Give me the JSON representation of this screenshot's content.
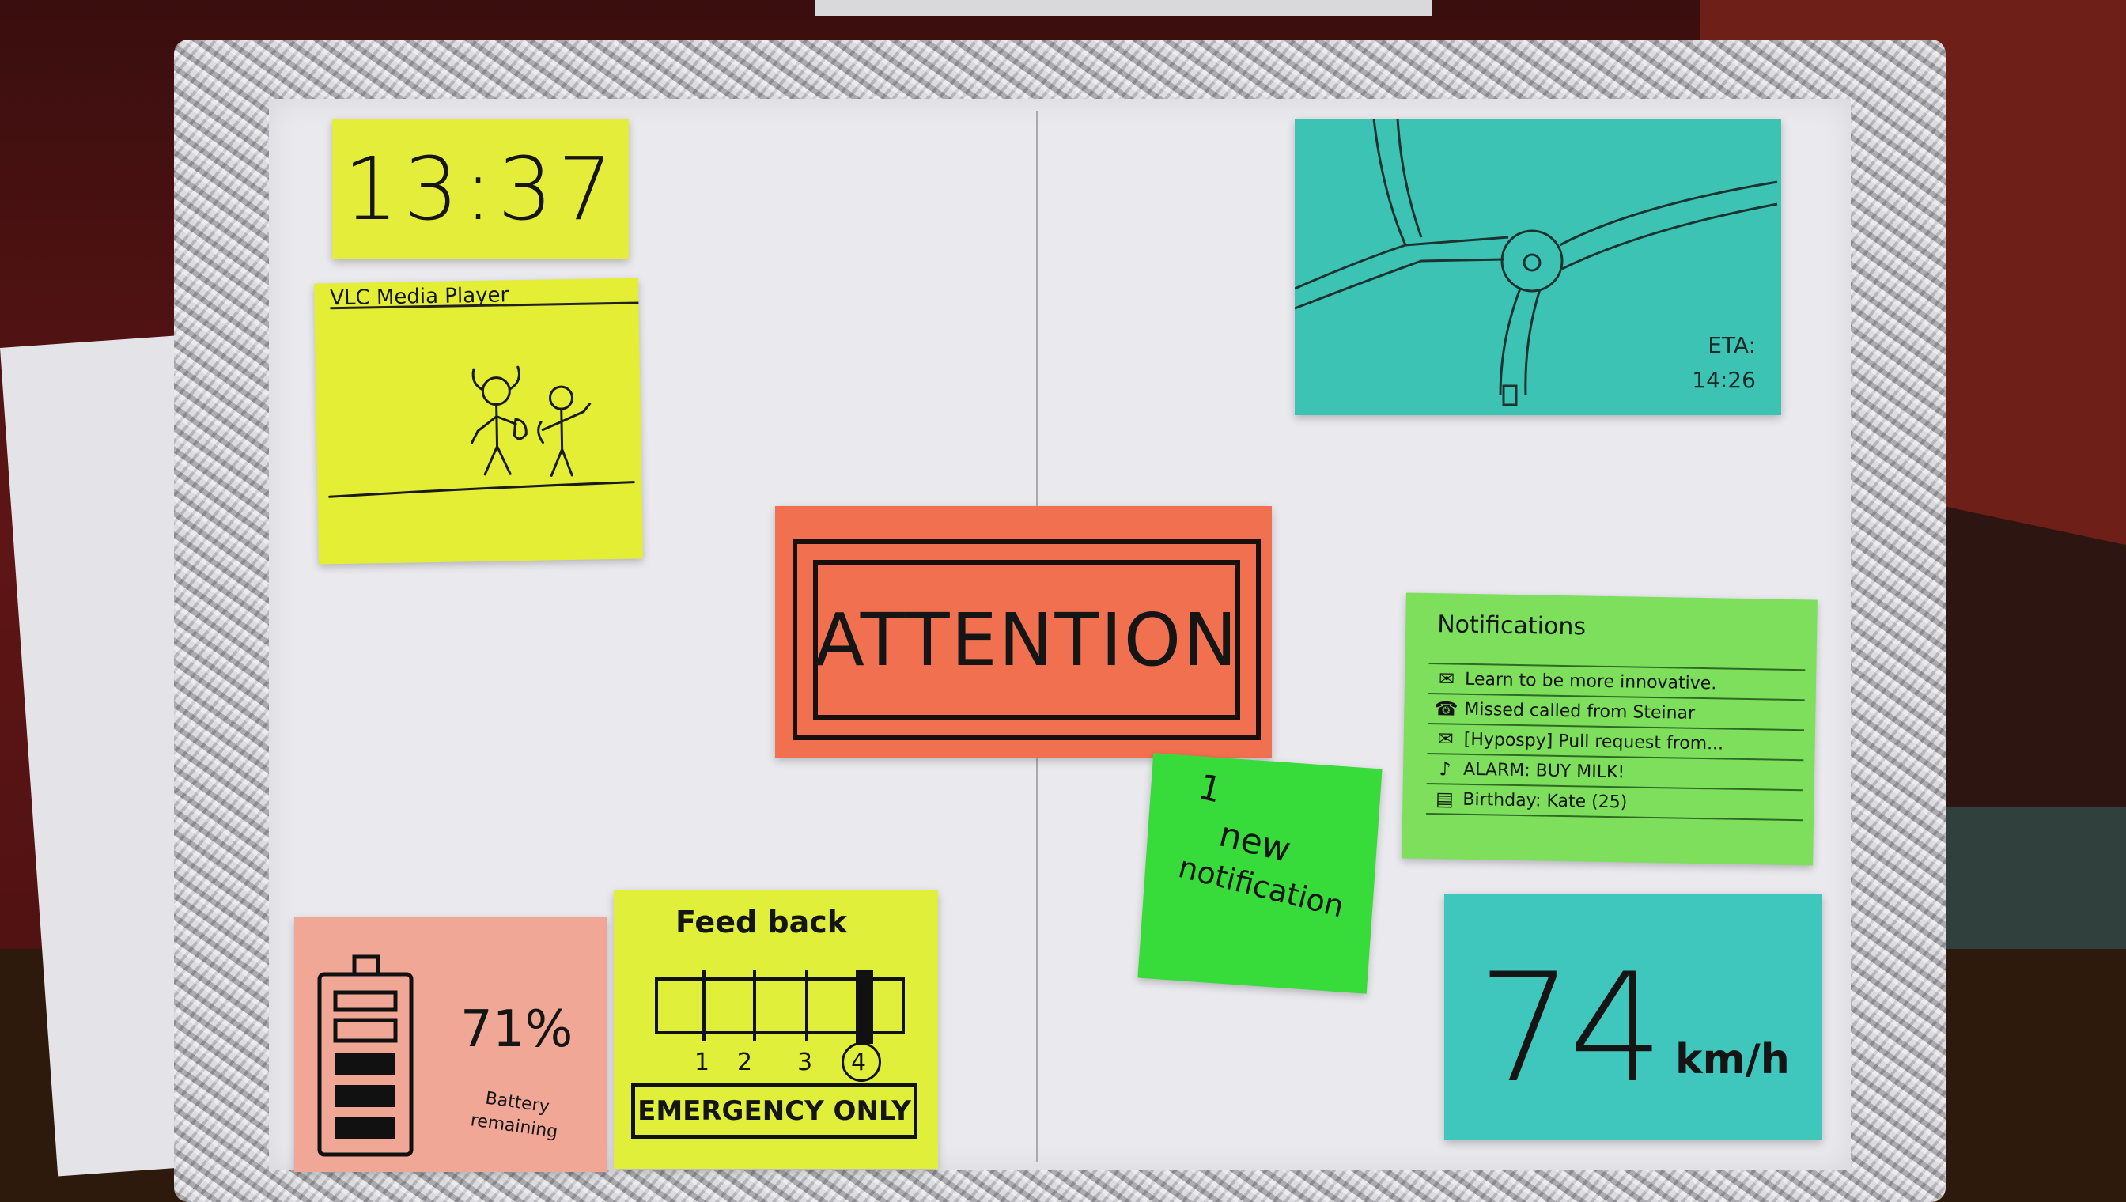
{
  "clock": {
    "time": "13:37"
  },
  "media_player": {
    "title": "VLC   Media Player"
  },
  "map": {
    "eta_label": "ETA:",
    "eta_time": "14:26"
  },
  "alert": {
    "label": "ATTENTION"
  },
  "new_notification": {
    "line1": "1",
    "line2": "new",
    "line3": "notification"
  },
  "notifications": {
    "title": "Notifications",
    "items": [
      {
        "icon": "envelope-icon",
        "text": "Learn to be more innovative."
      },
      {
        "icon": "phone-icon",
        "text": "Missed called from Steinar"
      },
      {
        "icon": "envelope-icon",
        "text": "[Hypospy] Pull request from..."
      },
      {
        "icon": "alarm-bell-icon",
        "text": "ALARM: BUY MILK!"
      },
      {
        "icon": "gift-icon",
        "text": "Birthday: Kate (25)"
      }
    ]
  },
  "battery": {
    "percent": "71%",
    "label_line1": "Battery",
    "label_line2": "remaining",
    "level": 0.71
  },
  "feedback": {
    "title": "Feed back",
    "levels": [
      "1",
      "2",
      "3",
      "4"
    ],
    "selected_level": "4",
    "emergency_label": "EMERGENCY ONLY"
  },
  "speed": {
    "value": "74",
    "unit": "km/h"
  },
  "colors": {
    "yellow_note": "#e3ee35",
    "teal_note": "#3dc3b4",
    "orange_note": "#f0704f",
    "green_note": "#7ddf5c",
    "bright_green_note": "#37dc3a",
    "pink_note": "#f0a795"
  }
}
